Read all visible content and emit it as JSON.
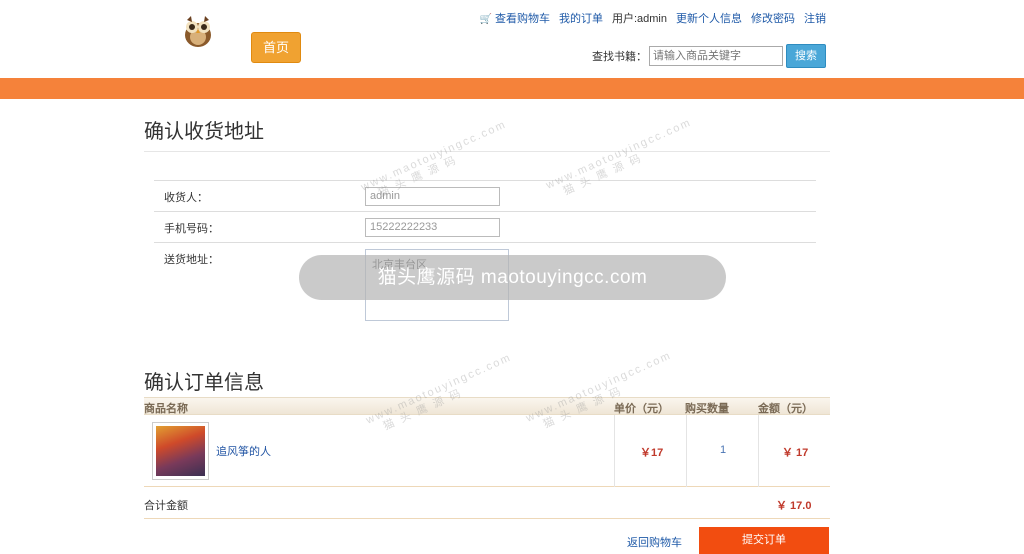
{
  "header": {
    "home_label": "首页",
    "links": {
      "cart": "查看购物车",
      "orders": "我的订单",
      "user": "用户:admin",
      "update_info": "更新个人信息",
      "change_password": "修改密码",
      "logout": "注销"
    },
    "search": {
      "label": "查找书籍：",
      "placeholder": "请输入商品关键字",
      "button": "搜索"
    }
  },
  "address": {
    "title": "确认收货地址",
    "fields": {
      "receiver_label": "收货人：",
      "receiver_value": "admin",
      "phone_label": "手机号码：",
      "phone_value": "15222222233",
      "address_label": "送货地址：",
      "address_value": "北京丰台区"
    }
  },
  "order": {
    "title": "确认订单信息",
    "headers": {
      "name": "商品名称",
      "unit_price": "单价（元）",
      "quantity": "购买数量",
      "amount": "金额（元）"
    },
    "items": [
      {
        "name": "追风筝的人",
        "unit_price": "￥17",
        "quantity": "1",
        "amount": "￥ 17"
      }
    ],
    "total_label": "合计金额",
    "total_value": "￥ 17.0",
    "back_link": "返回购物车",
    "submit": "提交订单"
  },
  "watermark": {
    "center": "猫头鹰源码 maotouyingcc.com",
    "diag_domain": "www.maotouyingcc.com",
    "diag_name": "猫 头 鹰 源 码"
  },
  "colors": {
    "orange_bar": "#f5823a",
    "home_button": "#f0a231",
    "search_button": "#4aa7d8",
    "submit_button": "#f24d10",
    "price_red": "#c0392b",
    "link_blue": "#1f5aa8"
  },
  "icons": [
    "owl-logo-icon",
    "cart-icon"
  ]
}
